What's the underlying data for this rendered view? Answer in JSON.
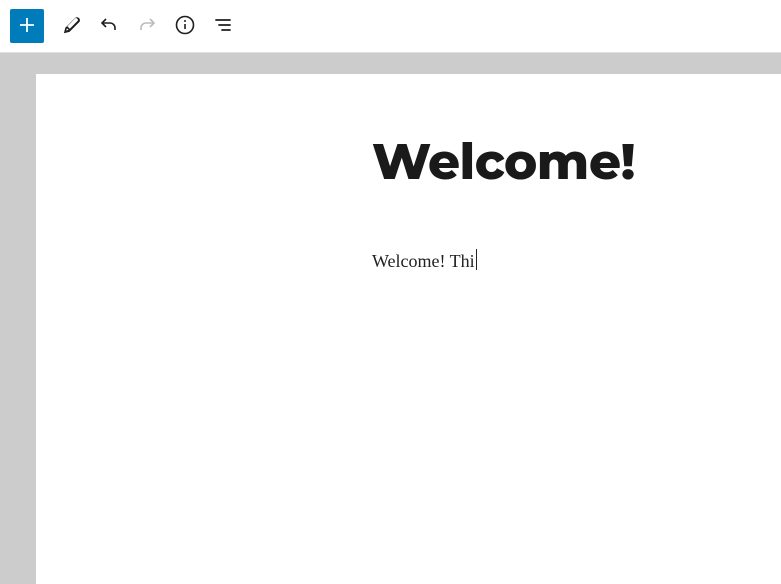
{
  "toolbar": {
    "add_label": "Add block",
    "edit_label": "Tools",
    "undo_label": "Undo",
    "redo_label": "Redo",
    "info_label": "Details",
    "outline_label": "Outline"
  },
  "editor": {
    "title": "Welcome!",
    "paragraph": "Welcome! Thi"
  }
}
